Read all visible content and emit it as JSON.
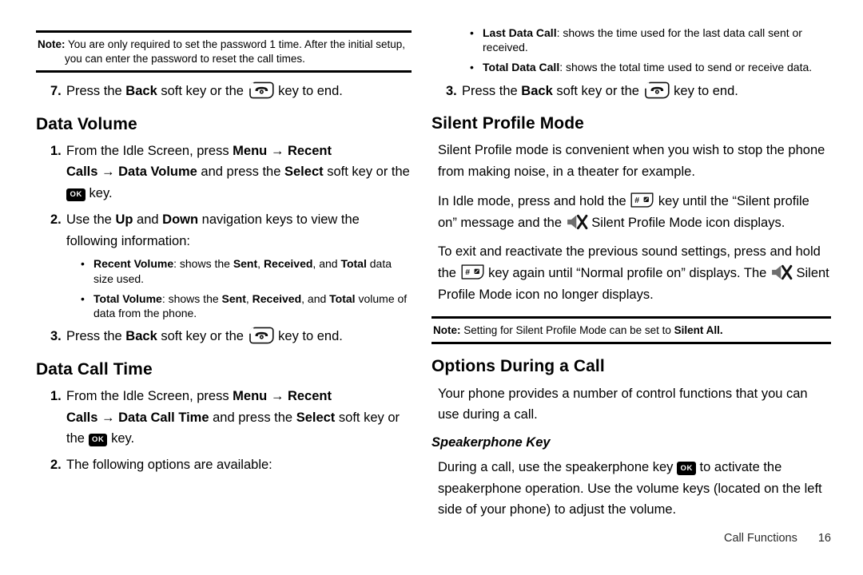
{
  "document": {
    "footer": {
      "section": "Call Functions",
      "page_number": "16"
    }
  },
  "left_column": {
    "note": {
      "label": "Note:",
      "line1": "You are only required to set the password 1 time. After the initial setup,",
      "line2": "you can enter the password to reset the call times."
    },
    "step7": {
      "number": "7.",
      "text_a": "Press the ",
      "bold_back": "Back",
      "text_b": " soft key or the ",
      "text_c": " key to end."
    },
    "data_volume": {
      "heading": "Data Volume",
      "step1": {
        "number": "1.",
        "text_a": "From the Idle Screen, press ",
        "bold_menu": "Menu",
        "arrow1": "→",
        "bold_recent_calls": "Recent Calls",
        "arrow2": "→",
        "bold_data_volume": "Data Volume",
        "text_b": " and press the ",
        "bold_select": "Select",
        "text_c": " soft key or the ",
        "text_d": "key."
      },
      "step2": {
        "number": "2.",
        "text_a": "Use the ",
        "bold_up": "Up",
        "text_b": " and ",
        "bold_down": "Down",
        "text_c": " navigation keys to view the following information:"
      },
      "bullets": [
        {
          "dot": "•",
          "bold_term": "Recent Volume",
          "text_a": ": shows the ",
          "bold_sent": "Sent",
          "text_b": ", ",
          "bold_received": "Received",
          "text_c": ", and ",
          "bold_total": "Total",
          "text_d": " data size used."
        },
        {
          "dot": "•",
          "bold_term": "Total Volume",
          "text_a": ": shows the ",
          "bold_sent": "Sent",
          "text_b": ", ",
          "bold_received": "Received",
          "text_c": ", and ",
          "bold_total": "Total",
          "text_d": " volume of data from the phone."
        }
      ],
      "step3": {
        "number": "3.",
        "text_a": "Press the ",
        "bold_back": "Back",
        "text_b": " soft key or the ",
        "text_c": " key to end."
      }
    },
    "data_call_time": {
      "heading": "Data Call Time",
      "step1": {
        "number": "1.",
        "text_a": "From the Idle Screen, press ",
        "bold_menu": "Menu",
        "arrow1": "→",
        "bold_recent_calls": "Recent Calls",
        "arrow2": "→",
        "bold_data_call_time": "Data Call Time",
        "text_b": " and press the ",
        "bold_select": "Select",
        "text_c": " soft key or the ",
        "text_d": "key."
      },
      "step2": {
        "number": "2.",
        "text_a": "The following options are available:"
      }
    }
  },
  "right_column": {
    "bullets": [
      {
        "dot": "•",
        "bold_term": "Last Data Call",
        "text_a": ": shows the time used for the last data call sent or received."
      },
      {
        "dot": "•",
        "bold_term": "Total Data Call",
        "text_a": ": shows the total time used to send or receive data."
      }
    ],
    "step3": {
      "number": "3.",
      "text_a": "Press the ",
      "bold_back": "Back",
      "text_b": " soft key or the ",
      "text_c": " key to end."
    },
    "silent_profile": {
      "heading": "Silent Profile Mode",
      "para1": "Silent Profile mode is convenient when you wish to stop the phone from making noise, in a theater for example.",
      "para2": {
        "text_a": "In Idle mode, press and hold the ",
        "text_b": " key until the “Silent profile on” message and the ",
        "text_c": " Silent Profile Mode icon displays."
      },
      "para3": {
        "text_a": "To exit and reactivate the previous sound settings, press and hold the ",
        "text_b": " key again until “Normal profile on” displays. The ",
        "text_c": " Silent Profile Mode icon no longer displays."
      },
      "note": {
        "label": "Note:",
        "text_a": "Setting for Silent Profile Mode can be set to ",
        "bold_silent_all": "Silent All."
      }
    },
    "options_during_call": {
      "heading": "Options During a Call",
      "para1": "Your phone provides a number of control functions that you can use during a call.",
      "subheading": "Speakerphone Key",
      "para2": {
        "text_a": "During a call, use the speakerphone key ",
        "text_b": " to activate the speakerphone operation. Use the volume keys (located on the left side of your phone) to adjust the volume."
      }
    }
  },
  "icons": {
    "ok_key_label": "OK",
    "hash_key_label": "#",
    "end_call_key": "end-call-key-icon",
    "silent_profile": "muted-speaker-icon"
  }
}
